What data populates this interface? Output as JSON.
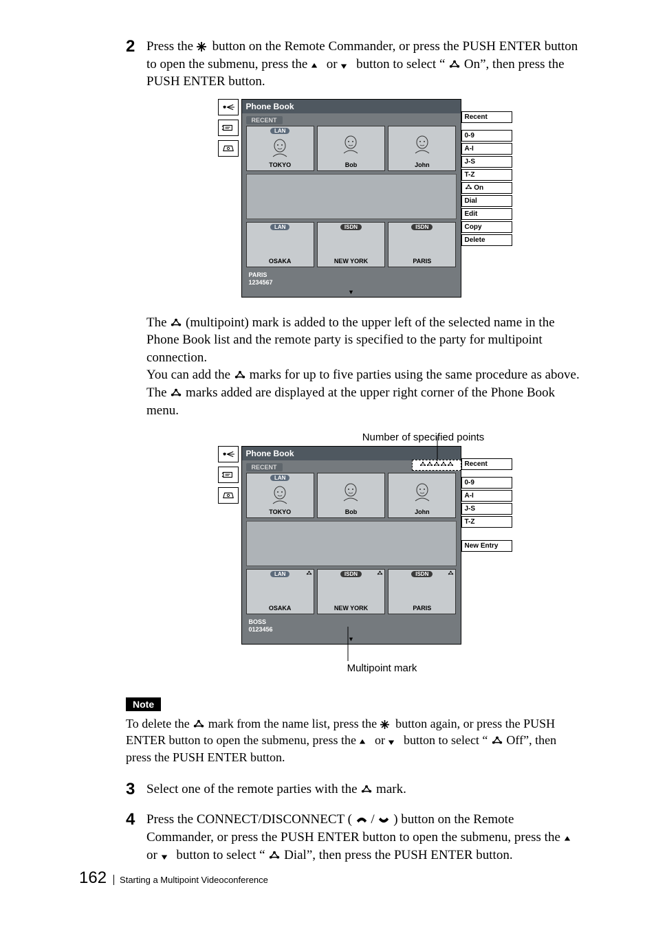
{
  "step2": {
    "num": "2",
    "line1a": "Press the ",
    "line1b": " button on the Remote Commander, or press the PUSH ENTER button to open the submenu, press the ",
    "line1c": " or ",
    "line1d": " button to select “",
    "line1e": " On”, then press the PUSH ENTER button."
  },
  "pb": {
    "title": "Phone Book",
    "recent_tab": "RECENT",
    "cards_row1": [
      {
        "tag": "LAN",
        "name": "TOKYO",
        "face": true,
        "tagClass": "lan"
      },
      {
        "tag": "",
        "name": "Bob",
        "face": true
      },
      {
        "tag": "",
        "name": "John",
        "face": true
      }
    ],
    "cards_row2": [
      {
        "tag": "LAN",
        "name": "OSAKA",
        "tagClass": "lan"
      },
      {
        "tag": "ISDN",
        "name": "NEW YORK",
        "tagClass": "isdn"
      },
      {
        "tag": "ISDN",
        "name": "PARIS",
        "tagClass": "isdn"
      }
    ],
    "selected1": {
      "name": "PARIS",
      "num": "1234567"
    },
    "selected2": {
      "name": "BOSS",
      "num": "0123456"
    },
    "pager": "▼"
  },
  "right1": [
    "Recent",
    "",
    "0-9",
    "A-I",
    "J-S",
    "T-Z",
    "  On",
    "Dial",
    "Edit",
    "Copy",
    "Delete"
  ],
  "right1_icon_prefix_index": 6,
  "right2": [
    "Recent",
    "",
    "0-9",
    "A-I",
    "J-S",
    "T-Z",
    "",
    "",
    "New Entry"
  ],
  "para_after_pb1": {
    "a": "The ",
    "b": " (multipoint) mark is added to the upper left of the selected name in the Phone Book list and the remote party is specified to the party for multipoint connection.",
    "c": "You can add the ",
    "d": " marks for up to five parties using the same procedure as above. The ",
    "e": " marks added are displayed at the upper right corner of the Phone Book menu."
  },
  "annotation_top": "Number of specified points",
  "annotation_bottom": "Multipoint mark",
  "note_label": "Note",
  "note_body": {
    "a": "To delete the ",
    "b": " mark from the name list, press the ",
    "c": " button again, or press the PUSH ENTER button to open the submenu, press the ",
    "d": " or ",
    "e": " button to select “",
    "f": " Off”, then press the PUSH ENTER button."
  },
  "step3": {
    "num": "3",
    "a": "Select one of the remote parties with the ",
    "b": " mark."
  },
  "step4": {
    "num": "4",
    "a": "Press the CONNECT/DISCONNECT ( ",
    "b": " / ",
    "c": " ) button on the Remote Commander, or press the PUSH ENTER button to open the submenu, press the ",
    "d": " or ",
    "e": " button to select “",
    "f": " Dial”, then press the PUSH ENTER button."
  },
  "footer": {
    "page": "162",
    "chapter": "Starting a Multipoint Videoconference"
  },
  "glyphs": {
    "star": "✳",
    "up": "▴",
    "down": "▾",
    "multipoint": " "
  }
}
